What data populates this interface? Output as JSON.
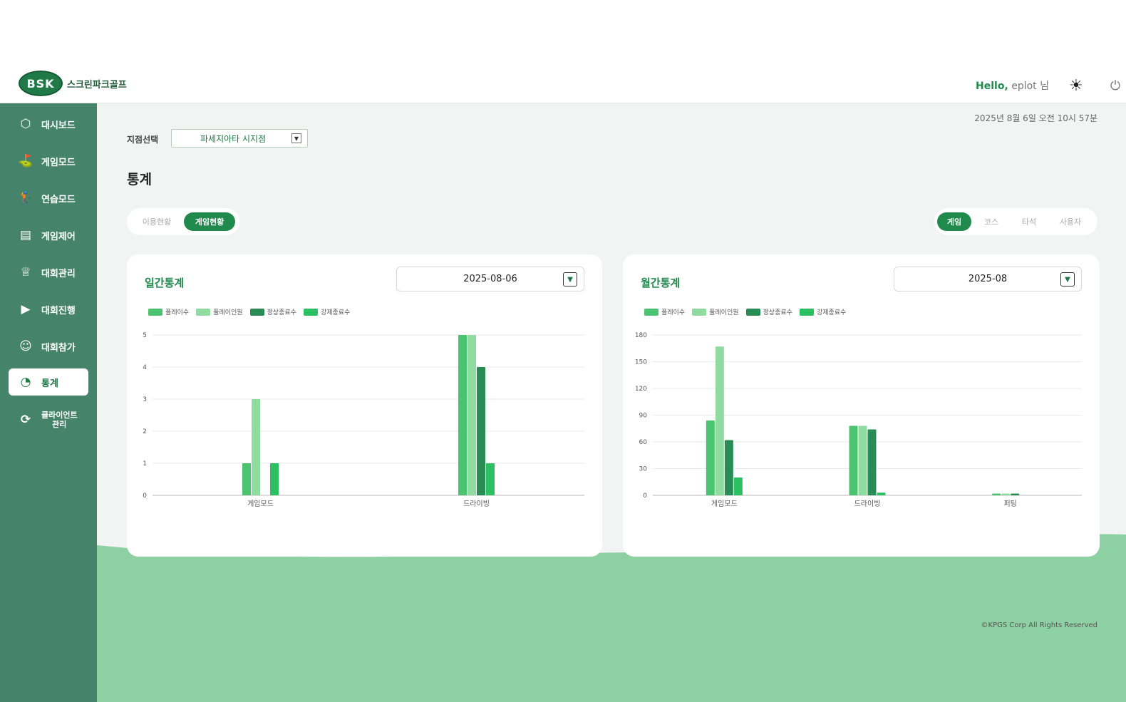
{
  "header": {
    "logo_mark": "BSK",
    "logo_text": "스크린파크골프",
    "hello_label": "Hello,",
    "user_name": "eplot 님",
    "theme_icon": "sun-icon",
    "power_icon": "power-icon"
  },
  "sidebar": {
    "items": [
      {
        "label": "대시보드",
        "icon": "cube-icon",
        "glyph": "⬡"
      },
      {
        "label": "게임모드",
        "icon": "golf-icon",
        "glyph": "⛳"
      },
      {
        "label": "연습모드",
        "icon": "practice-icon",
        "glyph": "🏌"
      },
      {
        "label": "게임제어",
        "icon": "document-icon",
        "glyph": "▤"
      },
      {
        "label": "대회관리",
        "icon": "trophy-icon",
        "glyph": "♕"
      },
      {
        "label": "대회진행",
        "icon": "play-icon",
        "glyph": "▶"
      },
      {
        "label": "대회참가",
        "icon": "person-icon",
        "glyph": "☺"
      },
      {
        "label": "통계",
        "icon": "chart-icon",
        "glyph": "◔"
      },
      {
        "label": "클라이언트\n관리",
        "icon": "refresh-icon",
        "glyph": "⟳"
      }
    ],
    "active_index": 7
  },
  "main": {
    "datetime": "2025년 8월 6일 오전 10시 57분",
    "branch_label": "지점선택",
    "branch_value": "파세지아타 시지점",
    "page_title": "통계",
    "left_tabs": [
      "이용현황",
      "게임현황"
    ],
    "left_tabs_active": 1,
    "right_tabs": [
      "게임",
      "코스",
      "타석",
      "사용자"
    ],
    "right_tabs_active": 0,
    "copyright": "©KPGS Corp All Rights Reserved"
  },
  "colors": {
    "play_count": "#4cc370",
    "players": "#8fdba0",
    "normal_end": "#2a8c55",
    "forced_end": "#2cc062"
  },
  "daily": {
    "title": "일간통계",
    "select_value": "2025-08-06"
  },
  "monthly": {
    "title": "월간통계",
    "select_value": "2025-08"
  },
  "chart_data": [
    {
      "type": "bar",
      "title": "일간통계",
      "categories": [
        "게임모드",
        "드라이빙"
      ],
      "ylim": [
        0,
        5
      ],
      "yticks": [
        0,
        1,
        2,
        3,
        4,
        5
      ],
      "grid": true,
      "legend": "top-left",
      "series": [
        {
          "name": "플레이수",
          "values": [
            1,
            5
          ]
        },
        {
          "name": "플레이인원",
          "values": [
            3,
            5
          ]
        },
        {
          "name": "정상종료수",
          "values": [
            0,
            4
          ]
        },
        {
          "name": "강제종료수",
          "values": [
            1,
            1
          ]
        }
      ]
    },
    {
      "type": "bar",
      "title": "월간통계",
      "categories": [
        "게임모드",
        "드라이빙",
        "퍼팅"
      ],
      "ylim": [
        0,
        180
      ],
      "yticks": [
        0,
        30,
        60,
        90,
        120,
        150,
        180
      ],
      "grid": true,
      "legend": "top-left",
      "series": [
        {
          "name": "플레이수",
          "values": [
            84,
            78,
            2
          ]
        },
        {
          "name": "플레이인원",
          "values": [
            167,
            78,
            2
          ]
        },
        {
          "name": "정상종료수",
          "values": [
            62,
            74,
            2
          ]
        },
        {
          "name": "강제종료수",
          "values": [
            20,
            3,
            0
          ]
        }
      ]
    }
  ]
}
